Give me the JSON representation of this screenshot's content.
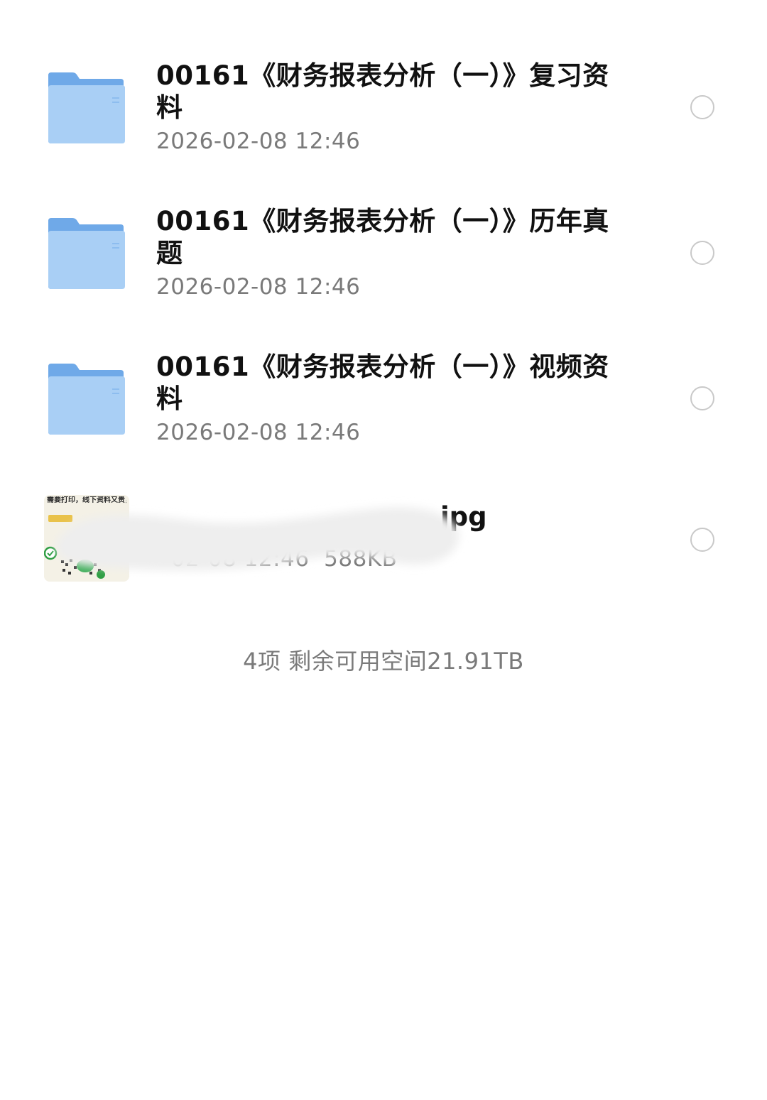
{
  "files": [
    {
      "type": "folder",
      "icon": "folder-icon",
      "name": "00161《财务报表分析（一）》复习资料",
      "modified": "2026-02-08 12:46"
    },
    {
      "type": "folder",
      "icon": "folder-icon",
      "name": "00161《财务报表分析（一）》历年真题",
      "modified": "2026-02-08 12:46"
    },
    {
      "type": "folder",
      "icon": "folder-icon",
      "name": "00161《财务报表分析（一）》视频资料",
      "modified": "2026-02-08 12:46"
    },
    {
      "type": "image",
      "icon": "image-thumbnail",
      "name_visible": "jpg",
      "meta_visible": "  02-08 12:46  588KB",
      "thumbnail_caption": "需要打印，线下资料又贵，大家直接注册 印邮寄"
    }
  ],
  "footer": {
    "summary": "4项 剩余可用空间21.91TB"
  },
  "colors": {
    "folder_front": "#a9cff5",
    "folder_back": "#6fa9e8",
    "title_text": "#111111",
    "meta_text": "#7a7a7a",
    "radio_border": "#c9c9c9",
    "background": "#ffffff"
  }
}
